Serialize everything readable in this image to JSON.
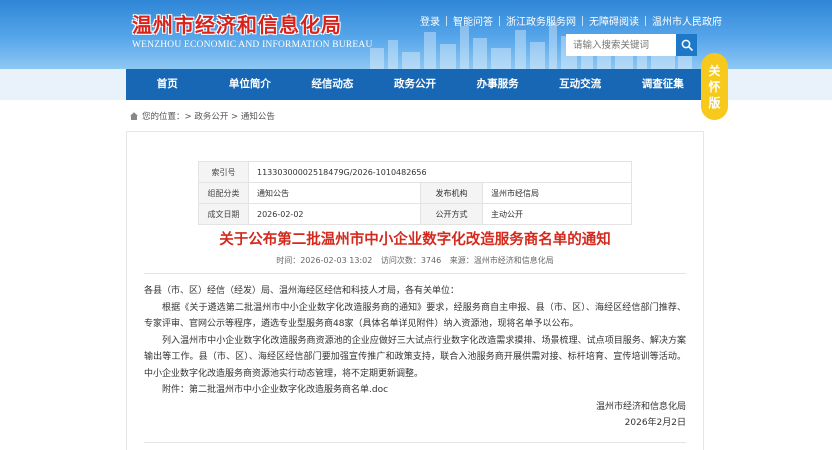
{
  "header": {
    "logo_cn": "温州市经济和信息化局",
    "logo_en": "WENZHOU ECONOMIC AND INFORMATION BUREAU",
    "top_links": [
      "登录",
      "智能问答",
      "浙江政务服务网",
      "无障碍阅读",
      "温州市人民政府"
    ],
    "search_placeholder": "请输入搜索关键词"
  },
  "nav": {
    "items": [
      "首页",
      "单位简介",
      "经信动态",
      "政务公开",
      "办事服务",
      "互动交流",
      "调查征集"
    ]
  },
  "care_mode": [
    "关",
    "怀",
    "版"
  ],
  "breadcrumb": {
    "label": "您的位置：",
    "path": "> 政务公开 > 通知公告"
  },
  "meta": {
    "index_label": "索引号",
    "index_value": "11330300002518479G/2026-1010482656",
    "category_label": "组配分类",
    "category_value": "通知公告",
    "publisher_label": "发布机构",
    "publisher_value": "温州市经信局",
    "date_label": "成文日期",
    "date_value": "2026-02-02",
    "mode_label": "公开方式",
    "mode_value": "主动公开"
  },
  "article": {
    "title": "关于公布第二批温州市中小企业数字化改造服务商名单的通知",
    "time": "时间：2026-02-03 13:02",
    "visits": "访问次数：3746",
    "source": "来源：温州市经济和信息化局",
    "salutation": "各县（市、区）经信（经发）局、温州海经区经信和科技人才局，各有关单位：",
    "para1": "根据《关于遴选第二批温州市中小企业数字化改造服务商的通知》要求，经服务商自主申报、县（市、区）、海经区经信部门推荐、专家评审、官网公示等程序，遴选专业型服务商48家（具体名单详见附件）纳入资源池，现将名单予以公布。",
    "para2": "列入温州市中小企业数字化改造服务商资源池的企业应做好三大试点行业数字化改造需求摸排、场景梳理、试点项目服务、解决方案输出等工作。县（市、区）、海经区经信部门要加强宣传推广和政策支持，联合入池服务商开展供需对接、标杆培育、宣传培训等活动。中小企业数字化改造服务商资源池实行动态管理，将不定期更新调整。",
    "attachment": "附件：第二批温州市中小企业数字化改造服务商名单.doc",
    "signature": "温州市经济和信息化局",
    "sign_date": "2026年2月2日"
  }
}
